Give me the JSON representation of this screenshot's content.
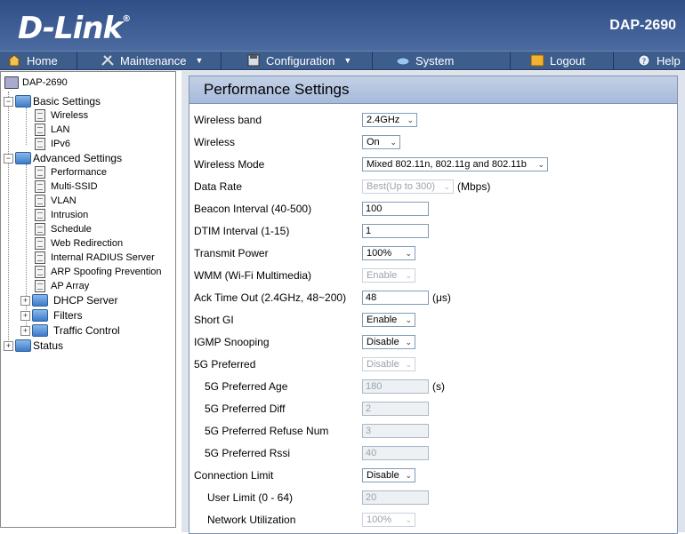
{
  "header": {
    "brand": "D-Link",
    "model": "DAP-2690"
  },
  "nav": [
    {
      "label": "Home",
      "icon": "home-icon",
      "caret": false
    },
    {
      "label": "Maintenance",
      "icon": "tools-icon",
      "caret": true
    },
    {
      "label": "Configuration",
      "icon": "disk-icon",
      "caret": true
    },
    {
      "label": "System",
      "icon": "system-icon",
      "caret": false
    },
    {
      "label": "Logout",
      "icon": "logout-icon",
      "caret": false
    },
    {
      "label": "Help",
      "icon": "help-icon",
      "caret": false
    }
  ],
  "sidebar": {
    "root": "DAP-2690",
    "basic": {
      "label": "Basic Settings",
      "items": [
        "Wireless",
        "LAN",
        "IPv6"
      ]
    },
    "advanced": {
      "label": "Advanced Settings",
      "items": [
        "Performance",
        "Multi-SSID",
        "VLAN",
        "Intrusion",
        "Schedule",
        "Web Redirection",
        "Internal RADIUS Server",
        "ARP Spoofing Prevention",
        "AP Array"
      ],
      "folders": [
        "DHCP Server",
        "Filters",
        "Traffic Control"
      ]
    },
    "status": "Status"
  },
  "panel": {
    "title": "Performance Settings",
    "rows": [
      {
        "label": "Wireless band",
        "type": "select",
        "value": "2.4GHz",
        "disabled": false
      },
      {
        "label": "Wireless",
        "type": "select",
        "value": "On",
        "disabled": false
      },
      {
        "label": "Wireless Mode",
        "type": "select",
        "value": "Mixed 802.11n, 802.11g and 802.11b",
        "disabled": false
      },
      {
        "label": "Data Rate",
        "type": "select",
        "value": "Best(Up to 300)",
        "disabled": true,
        "unit": "(Mbps)"
      },
      {
        "label": "Beacon Interval (40-500)",
        "type": "input",
        "value": "100",
        "disabled": false
      },
      {
        "label": "DTIM Interval (1-15)",
        "type": "input",
        "value": "1",
        "disabled": false
      },
      {
        "label": "Transmit Power",
        "type": "select",
        "value": "100%",
        "disabled": false
      },
      {
        "label": "WMM (Wi-Fi Multimedia)",
        "type": "select",
        "value": "Enable",
        "disabled": true
      },
      {
        "label": "Ack Time Out  (2.4GHz, 48~200)",
        "type": "input",
        "value": "48",
        "disabled": false,
        "unit": "(μs)"
      },
      {
        "label": "Short GI",
        "type": "select",
        "value": "Enable",
        "disabled": false
      },
      {
        "label": "IGMP Snooping",
        "type": "select",
        "value": "Disable",
        "disabled": false
      },
      {
        "label": "5G Preferred",
        "type": "select",
        "value": "Disable",
        "disabled": true
      },
      {
        "label": "5G Preferred Age",
        "type": "input",
        "value": "180",
        "disabled": true,
        "unit": "(s)",
        "indent": true
      },
      {
        "label": "5G Preferred Diff",
        "type": "input",
        "value": "2",
        "disabled": true,
        "indent": true
      },
      {
        "label": "5G Preferred Refuse Num",
        "type": "input",
        "value": "3",
        "disabled": true,
        "indent": true
      },
      {
        "label": "5G Preferred Rssi",
        "type": "input",
        "value": "40",
        "disabled": true,
        "indent": true
      },
      {
        "label": "Connection Limit",
        "type": "select",
        "value": "Disable",
        "disabled": false
      },
      {
        "label": "User Limit (0 - 64)",
        "type": "input",
        "value": "20",
        "disabled": true,
        "indent": true
      },
      {
        "label": "Network Utilization",
        "type": "select",
        "value": "100%",
        "disabled": true,
        "indent": true
      }
    ]
  }
}
